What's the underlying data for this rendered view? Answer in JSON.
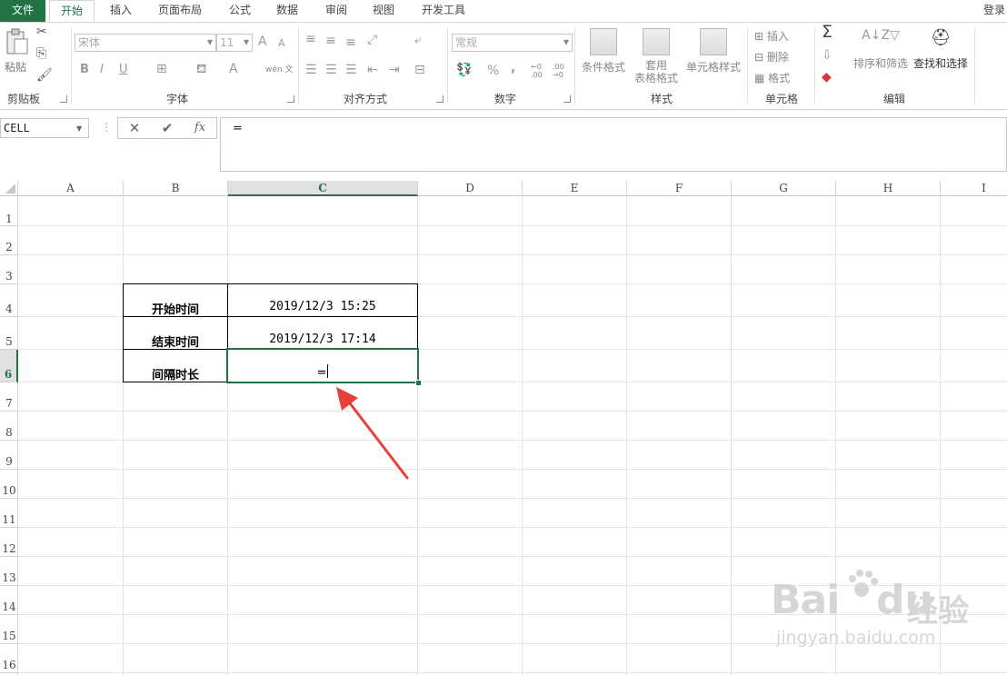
{
  "menu": {
    "tabs": [
      "文件",
      "开始",
      "插入",
      "页面布局",
      "公式",
      "数据",
      "审阅",
      "视图",
      "开发工具"
    ],
    "signin": "登录"
  },
  "ribbon": {
    "clipboard": {
      "label": "剪贴板",
      "paste": "粘贴"
    },
    "font": {
      "label": "字体",
      "name": "宋体",
      "size": "11",
      "bold": "B",
      "italic": "I",
      "underline": "U",
      "grow": "A",
      "shrink": "A",
      "color": "A",
      "phonetic": "wén 文"
    },
    "alignment": {
      "label": "对齐方式"
    },
    "number": {
      "label": "数字",
      "format": "常规",
      "percent": "%",
      "comma": ",",
      "inc": "←0 .00",
      "dec": ".00 →0"
    },
    "styles": {
      "label": "样式",
      "conditional": "条件格式",
      "table1": "套用",
      "table2": "表格格式",
      "cellstyle": "单元格样式"
    },
    "cells": {
      "label": "单元格",
      "insert": "插入",
      "delete": "删除",
      "format": "格式"
    },
    "editing": {
      "label": "编辑",
      "sum": "Σ",
      "sort": "排序和筛选",
      "find": "查找和选择"
    }
  },
  "formula_bar": {
    "name_box": "CELL",
    "cancel": "✕",
    "enter": "✔",
    "fx": "fx",
    "content": "="
  },
  "sheet": {
    "columns": [
      "A",
      "B",
      "C",
      "D",
      "E",
      "F",
      "G",
      "H",
      "I"
    ],
    "rows": [
      "1",
      "2",
      "3",
      "4",
      "5",
      "6",
      "7",
      "8",
      "9",
      "10",
      "11",
      "12",
      "13",
      "14",
      "15",
      "16"
    ],
    "b4": "开始时间",
    "c4": "2019/12/3 15:25",
    "b5": "结束时间",
    "c5": "2019/12/3 17:14",
    "b6": "间隔时长",
    "c6": "="
  },
  "watermark": {
    "brand": "Bai",
    "brand2": "du",
    "sub": "经验",
    "url": "jingyan.baidu.com"
  },
  "colors": {
    "accent": "#217346",
    "arrow": "#e8413a"
  }
}
